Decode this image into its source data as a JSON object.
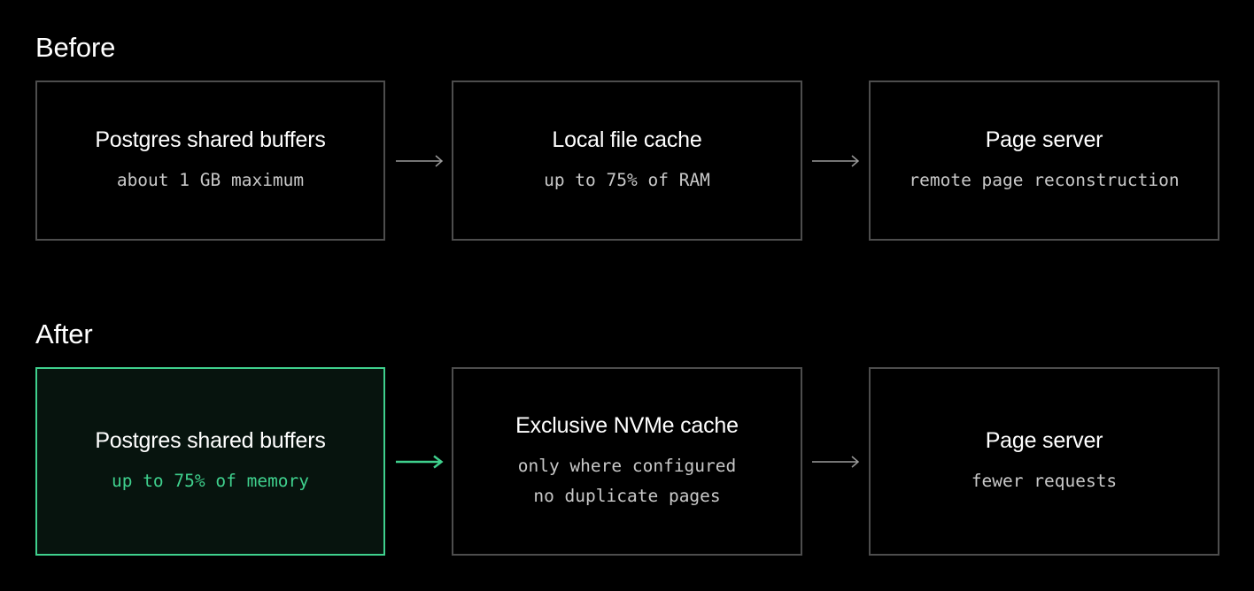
{
  "before": {
    "title": "Before",
    "boxes": [
      {
        "title": "Postgres shared buffers",
        "lines": [
          "about 1 GB maximum"
        ]
      },
      {
        "title": "Local file cache",
        "lines": [
          "up to 75% of RAM"
        ]
      },
      {
        "title": "Page server",
        "lines": [
          "remote page reconstruction"
        ]
      }
    ]
  },
  "after": {
    "title": "After",
    "boxes": [
      {
        "title": "Postgres shared buffers",
        "lines": [
          "up to 75% of memory"
        ]
      },
      {
        "title": "Exclusive NVMe cache",
        "lines": [
          "only where configured",
          "no duplicate pages"
        ]
      },
      {
        "title": "Page server",
        "lines": [
          "fewer requests"
        ]
      }
    ]
  },
  "colors": {
    "background": "#000000",
    "box_border": "#4d4d4d",
    "highlight": "#3fd08d",
    "highlight_fill": "#07140e",
    "arrow": "#9a9a9a",
    "subtext": "#c8c8c8"
  },
  "icons": {
    "arrow": "arrow-right-icon"
  }
}
